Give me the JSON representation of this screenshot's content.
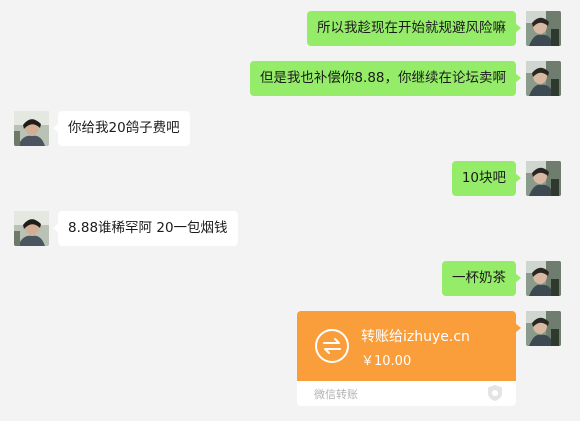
{
  "chat": {
    "messages": [
      {
        "sender": "me",
        "text": "所以我趁现在开始就规避风险嘛"
      },
      {
        "sender": "me",
        "text": "但是我也补偿你8.88，你继续在论坛卖啊"
      },
      {
        "sender": "other",
        "text": "你给我20鸽子费吧"
      },
      {
        "sender": "me",
        "text": "10块吧"
      },
      {
        "sender": "other",
        "text": "8.88谁稀罕阿 20一包烟钱"
      },
      {
        "sender": "me",
        "text": "一杯奶茶"
      }
    ],
    "transfer": {
      "title": "转账给izhuye.cn",
      "amount": "￥10.00",
      "footer": "微信转账",
      "icon": "transfer-arrows-icon",
      "color": "#fa9d3b"
    }
  },
  "colors": {
    "background": "#f3f3f3",
    "my_bubble": "#95ec69",
    "their_bubble": "#ffffff"
  }
}
